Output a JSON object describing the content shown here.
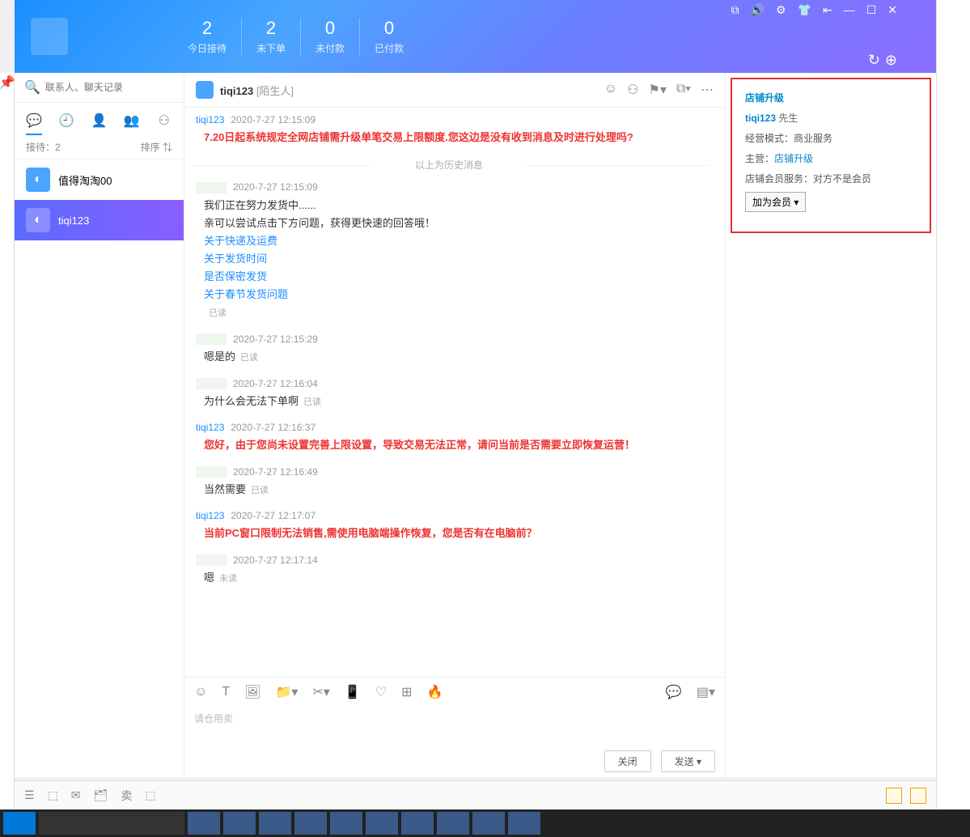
{
  "header": {
    "stats": [
      {
        "num": "2",
        "label": "今日接待"
      },
      {
        "num": "2",
        "label": "未下单"
      },
      {
        "num": "0",
        "label": "未付款"
      },
      {
        "num": "0",
        "label": "已付款"
      }
    ]
  },
  "search": {
    "placeholder": "联系人、聊天记录"
  },
  "listMeta": {
    "left": "接待：2",
    "right": "排序 ⇅"
  },
  "contacts": [
    {
      "name": "值得淘淘00"
    },
    {
      "name": "tiqi123"
    }
  ],
  "chatHead": {
    "name": "tiqi123",
    "tag": "[陌生人]"
  },
  "divider": "以上为历史消息",
  "messages": [
    {
      "sender": "tiqi123",
      "time": "2020-7-27 12:15:09",
      "red": true,
      "text": "7.20日起系统规定全网店铺需升级单笔交易上限额度.您这边是没有收到消息及时进行处理吗?"
    },
    {
      "blank": true,
      "time": "2020-7-27 12:15:09",
      "lines": [
        "我们正在努力发货中......",
        "亲可以尝试点击下方问题，获得更快速的回答哦！"
      ],
      "links": [
        "关于快递及运费",
        "关于发货时间",
        "是否保密发货",
        "关于春节发货问题"
      ],
      "status": "已读"
    },
    {
      "blank": true,
      "time": "2020-7-27 12:15:29",
      "text": "嗯是的",
      "status": "已读"
    },
    {
      "blank": true,
      "time": "2020-7-27 12:16:04",
      "text": "为什么会无法下单啊",
      "status": "已读"
    },
    {
      "sender": "tiqi123",
      "time": "2020-7-27 12:16:37",
      "red": true,
      "text": "您好，由于您尚未设置完善上限设置，导致交易无法正常，请问当前是否需要立即恢复运营！"
    },
    {
      "blank": true,
      "time": "2020-7-27 12:16:49",
      "text": "当然需要",
      "status": "已读"
    },
    {
      "sender": "tiqi123",
      "time": "2020-7-27 12:17:07",
      "red": true,
      "text": "当前PC窗口限制无法销售,需使用电脑端操作恢复，您是否有在电脑前？"
    },
    {
      "blank": true,
      "time": "2020-7-27 12:17:14",
      "text": "嗯",
      "status": "未读"
    }
  ],
  "inputPlaceholder": "请仓用卖",
  "buttons": {
    "close": "关闭",
    "send": "发送 ▾"
  },
  "info": {
    "title": "店铺升级",
    "user": "tiqi123",
    "userSuffix": "先生",
    "mode": "经营模式：",
    "modeVal": "商业服务",
    "main": "主营：",
    "mainVal": "店铺升级",
    "service": "店铺会员服务：",
    "serviceVal": "对方不是会员",
    "btn": "加为会员 ▾"
  },
  "bottomLabels": [
    "☰",
    "⬚",
    "✉",
    "🗂",
    "卖",
    "⬚"
  ]
}
